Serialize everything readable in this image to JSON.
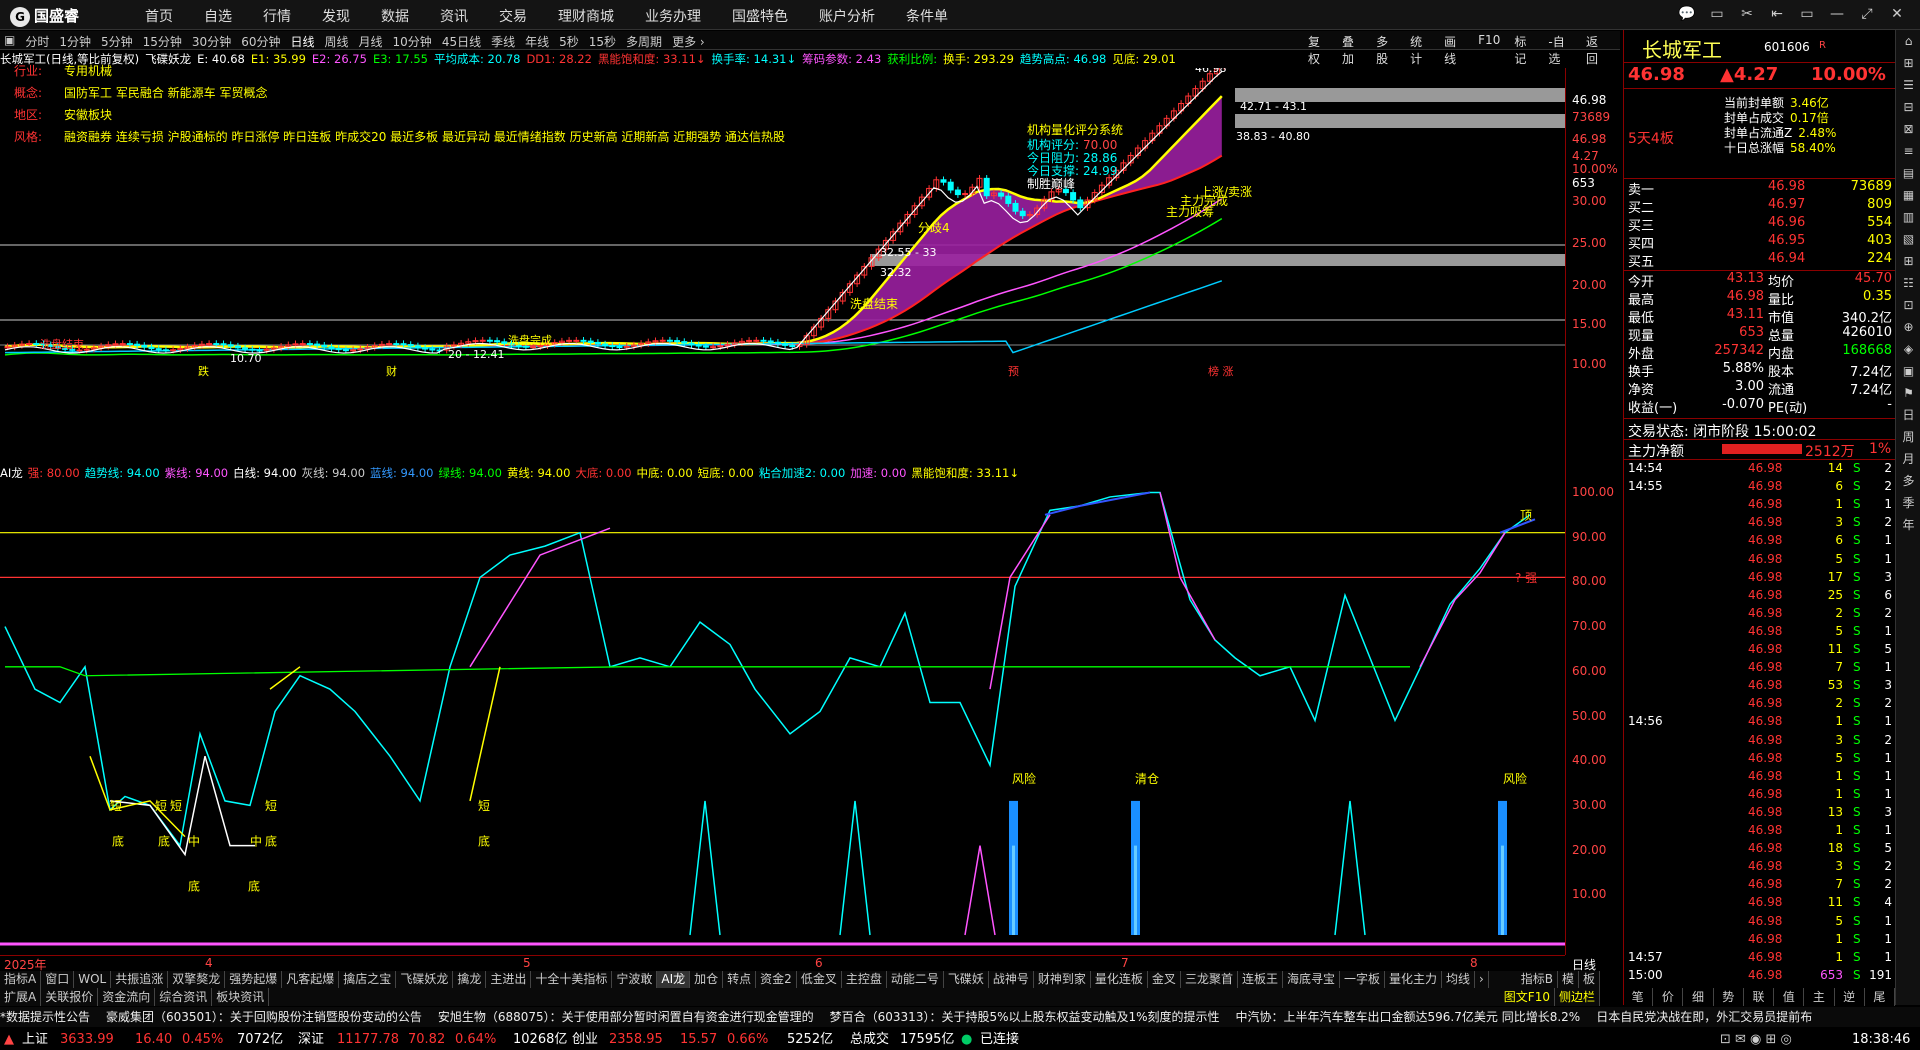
{
  "app": {
    "logo_text": "国盛睿"
  },
  "menu": [
    "首页",
    "自选",
    "行情",
    "发现",
    "数据",
    "资讯",
    "交易",
    "理财商城",
    "业务办理",
    "国盛特色",
    "账户分析",
    "条件单"
  ],
  "window_buttons": [
    "💬",
    "▭",
    "✂",
    "⇤",
    "▭",
    "—",
    "⤢",
    "✕"
  ],
  "periods": [
    "▣",
    "分时",
    "1分钟",
    "5分钟",
    "15分钟",
    "30分钟",
    "60分钟",
    "日线",
    "周线",
    "月线",
    "10分钟",
    "45日线",
    "季线",
    "年线",
    "5秒",
    "15秒",
    "多周期",
    "更多 ›"
  ],
  "period_active": "日线",
  "toolbar_right": [
    "复权",
    "叠加",
    "多股",
    "统计",
    "画线",
    "F10",
    "标记",
    "-自选",
    "返回"
  ],
  "infobar": [
    {
      "t": "长城军工(日线,等比前复权)",
      "c": "#ffffff"
    },
    {
      "t": "飞碟妖龙",
      "c": "#ffffff"
    },
    {
      "t": "E: 40.68",
      "c": "#ffffff"
    },
    {
      "t": "E1: 35.99",
      "c": "#ffff00"
    },
    {
      "t": "E2: 26.75",
      "c": "#ff55ff"
    },
    {
      "t": "E3: 17.55",
      "c": "#00ff00"
    },
    {
      "t": "平均成本: 20.78",
      "c": "#00ffff"
    },
    {
      "t": "DD1: 28.22",
      "c": "#ff3333"
    },
    {
      "t": "黑能饱和度: 33.11↓",
      "c": "#ff3333"
    },
    {
      "t": "换手率: 14.31↓",
      "c": "#00ffff"
    },
    {
      "t": "筹码参数: 2.43",
      "c": "#ff55ff"
    },
    {
      "t": "获利比例:",
      "c": "#00ff00"
    },
    {
      "t": "换手: 293.29",
      "c": "#ffff00"
    },
    {
      "t": "趋势高点: 46.98",
      "c": "#00ffff"
    },
    {
      "t": "见底: 29.01",
      "c": "#ffff00"
    }
  ],
  "overlay_info": [
    {
      "k": "行业:",
      "v": "专用机械"
    },
    {
      "k": "概念:",
      "v": "国防军工 军民融合 新能源车 军贸概念"
    },
    {
      "k": "地区:",
      "v": "安徽板块"
    },
    {
      "k": "风格:",
      "v": "融资融券 连续亏损 沪股通标的 昨日涨停 昨日连板 昨成交20 最近多板 最近异动 最近情绪指数 历史新高 近期新高 近期强势 通达信热股"
    }
  ],
  "scoring": {
    "title": "机构量化评分系统",
    "rows": [
      {
        "k": "机构评分:",
        "v": "70.00",
        "c": "#ff4444"
      },
      {
        "k": "今日阻力:",
        "v": "28.86",
        "c": "#00ffff"
      },
      {
        "k": "今日支撑:",
        "v": "24.99",
        "c": "#00ffff"
      },
      {
        "k": "制胜巅峰",
        "v": "",
        "c": "#ffffff"
      }
    ]
  },
  "chart_labels": {
    "high": "46.98",
    "lvl1": "42.71 - 43.1",
    "lvl2": "38.83 - 40.80",
    "low1": "10.70",
    "low2": "20 - 12.41",
    "mid1": "32.55 - 33",
    "mid2": "32.32",
    "top_text": "5天4板",
    "ann1": "洗盘结束",
    "ann2": "分歧4",
    "ann3": "洗盘结束",
    "ann4": "主力吸筹",
    "ann5": "主力完成",
    "ann6": "上涨/卖涨",
    "ann7": "洗盘完成",
    "bot1": "跌",
    "bot2": "财",
    "bot3": "预",
    "bot4": "榜 涨"
  },
  "main_axis": {
    "top_vals": [
      "46.98",
      "73689",
      "46.98",
      "4.27",
      "10.00%",
      "653"
    ],
    "ticks": [
      "30.00",
      "25.00",
      "20.00",
      "15.00",
      "10.00"
    ]
  },
  "subinfo": [
    {
      "t": "AI龙",
      "c": "#ffffff"
    },
    {
      "t": "强: 80.00",
      "c": "#ff3333"
    },
    {
      "t": "趋势线: 94.00",
      "c": "#00ffff"
    },
    {
      "t": "紫线: 94.00",
      "c": "#ff55ff"
    },
    {
      "t": "白线: 94.00",
      "c": "#ffffff"
    },
    {
      "t": "灰线: 94.00",
      "c": "#cccccc"
    },
    {
      "t": "蓝线: 94.00",
      "c": "#3399ff"
    },
    {
      "t": "绿线: 94.00",
      "c": "#00ff00"
    },
    {
      "t": "黄线: 94.00",
      "c": "#ffff00"
    },
    {
      "t": "大底: 0.00",
      "c": "#ff3333"
    },
    {
      "t": "中底: 0.00",
      "c": "#ffff00"
    },
    {
      "t": "短底: 0.00",
      "c": "#ffff00"
    },
    {
      "t": "粘合加速2: 0.00",
      "c": "#00ffff"
    },
    {
      "t": "加速: 0.00",
      "c": "#ff55ff"
    },
    {
      "t": "黑能饱和度: 33.11↓",
      "c": "#ffff00"
    }
  ],
  "sub_labels": {
    "ding": "顶",
    "qiang": "? 强",
    "fx1": "风险",
    "qc": "清仓",
    "fx2": "风险",
    "duan": "短",
    "di": "底",
    "zhong": "中"
  },
  "sub_axis": [
    "100.00",
    "90.00",
    "80.00",
    "70.00",
    "60.00",
    "50.00",
    "40.00",
    "30.00",
    "20.00",
    "10.00"
  ],
  "date_axis": [
    {
      "t": "2025年"
    },
    {
      "t": "4"
    },
    {
      "t": "5"
    },
    {
      "t": "6"
    },
    {
      "t": "7"
    },
    {
      "t": "8"
    }
  ],
  "tabs1": [
    "指标A",
    "窗口",
    "WOL",
    "共振追涨",
    "双擎獒龙",
    "强势起爆",
    "凡客起爆",
    "擒店之宝",
    "飞碟妖龙",
    "擒龙",
    "主进出",
    "十全十美指标",
    "宁波敢",
    "AI龙",
    "加仓",
    "转点",
    "资金2",
    "低金叉",
    "主控盘",
    "动能二号",
    "飞碟妖",
    "战神号",
    "财神到家",
    "量化连板",
    "金叉",
    "三龙聚首",
    "连板王",
    "海底寻宝",
    "一字板",
    "量化主力",
    "均线",
    "›"
  ],
  "tabs1_right": [
    "指标B",
    "模",
    "板"
  ],
  "tabs2": [
    "扩展A",
    "关联报价",
    "资金流向",
    "综合资讯",
    "板块资讯"
  ],
  "tabs2_right": [
    "图文F10",
    "侧边栏"
  ],
  "ticker": [
    "*数据提示性公告",
    "豪威集团（603501）：关于回购股份注销暨股份变动的公告",
    "安旭生物（688075）：关于使用部分暂时闲置自有资金进行现金管理的",
    "梦百合（603313）：关于持股5%以上股东权益变动触及1%刻度的提示性",
    "中汽协：上半年汽车整车出口金额达596.7亿美元 同比增长8.2%",
    "日本自民党决战在即，外汇交易员提前布"
  ],
  "status": {
    "sh_label": "上证",
    "sh_val": "3633.99",
    "sh_chg": "16.40",
    "sh_pct": "0.45%",
    "sh_amt": "7072亿",
    "sz_label": "深证",
    "sz_val": "11177.78",
    "sz_chg": "70.82",
    "sz_pct": "0.64%",
    "sz_amt": "10268亿",
    "cy_label": "创业",
    "cy_val": "2358.95",
    "cy_chg": "15.57",
    "cy_pct": "0.66%",
    "cy_amt": "5252亿",
    "total_label": "总成交",
    "total_val": "17595亿",
    "conn": "已连接",
    "time": "18:38:46"
  },
  "quote": {
    "name": "长城军工",
    "code": "601606",
    "price": "46.98",
    "change": "▲4.27",
    "pct": "10.00%",
    "info": [
      {
        "k": "当前封单额",
        "v": "3.46亿"
      },
      {
        "k": "封单占成交",
        "v": "0.17倍"
      },
      {
        "k": "封单占流通Z",
        "v": "2.48%"
      },
      {
        "k": "十日总涨幅",
        "v": "58.40%"
      }
    ],
    "board_tag": "5天4板",
    "bids": [
      {
        "k": "卖一",
        "p": "46.98",
        "v": "73689"
      },
      {
        "k": "买二",
        "p": "46.97",
        "v": "809"
      },
      {
        "k": "买三",
        "p": "46.96",
        "v": "554"
      },
      {
        "k": "买四",
        "p": "46.95",
        "v": "403"
      },
      {
        "k": "买五",
        "p": "46.94",
        "v": "224"
      }
    ],
    "stats": [
      {
        "k1": "今开",
        "v1": "43.13",
        "k2": "均价",
        "v2": "45.70"
      },
      {
        "k1": "最高",
        "v1": "46.98",
        "k2": "量比",
        "v2": "0.35"
      },
      {
        "k1": "最低",
        "v1": "43.11",
        "k2": "市值",
        "v2": "340.2亿"
      },
      {
        "k1": "现量",
        "v1": "653",
        "k2": "总量",
        "v2": "426010"
      },
      {
        "k1": "外盘",
        "v1": "257342",
        "k2": "内盘",
        "v2": "168668"
      },
      {
        "k1": "换手",
        "v1": "5.88%",
        "k2": "股本",
        "v2": "7.24亿"
      },
      {
        "k1": "净资",
        "v1": "3.00",
        "k2": "流通",
        "v2": "7.24亿"
      },
      {
        "k1": "收益(一)",
        "v1": "-0.070",
        "k2": "PE(动)",
        "v2": "-"
      }
    ],
    "trade_status": "交易状态: 闭市阶段 15:00:02",
    "net_label": "主力净额",
    "net_val": "2512万",
    "net_pct": "1%",
    "ticks": [
      [
        "14:54",
        "46.98",
        "14",
        "S",
        "2"
      ],
      [
        "14:55",
        "46.98",
        "6",
        "S",
        "2"
      ],
      [
        "",
        "46.98",
        "1",
        "S",
        "1"
      ],
      [
        "",
        "46.98",
        "3",
        "S",
        "2"
      ],
      [
        "",
        "46.98",
        "6",
        "S",
        "1"
      ],
      [
        "",
        "46.98",
        "5",
        "S",
        "1"
      ],
      [
        "",
        "46.98",
        "17",
        "S",
        "3"
      ],
      [
        "",
        "46.98",
        "25",
        "S",
        "6"
      ],
      [
        "",
        "46.98",
        "2",
        "S",
        "2"
      ],
      [
        "",
        "46.98",
        "5",
        "S",
        "1"
      ],
      [
        "",
        "46.98",
        "11",
        "S",
        "5"
      ],
      [
        "",
        "46.98",
        "7",
        "S",
        "1"
      ],
      [
        "",
        "46.98",
        "53",
        "S",
        "3"
      ],
      [
        "",
        "46.98",
        "2",
        "S",
        "2"
      ],
      [
        "14:56",
        "46.98",
        "1",
        "S",
        "1"
      ],
      [
        "",
        "46.98",
        "3",
        "S",
        "2"
      ],
      [
        "",
        "46.98",
        "5",
        "S",
        "1"
      ],
      [
        "",
        "46.98",
        "1",
        "S",
        "1"
      ],
      [
        "",
        "46.98",
        "1",
        "S",
        "1"
      ],
      [
        "",
        "46.98",
        "13",
        "S",
        "3"
      ],
      [
        "",
        "46.98",
        "1",
        "S",
        "1"
      ],
      [
        "",
        "46.98",
        "18",
        "S",
        "5"
      ],
      [
        "",
        "46.98",
        "3",
        "S",
        "2"
      ],
      [
        "",
        "46.98",
        "7",
        "S",
        "2"
      ],
      [
        "",
        "46.98",
        "11",
        "S",
        "4"
      ],
      [
        "",
        "46.98",
        "5",
        "S",
        "1"
      ],
      [
        "",
        "46.98",
        "1",
        "S",
        "1"
      ],
      [
        "14:57",
        "46.98",
        "1",
        "S",
        "1"
      ],
      [
        "15:00",
        "46.98",
        "653",
        "S",
        "191"
      ]
    ],
    "bottom_tabs": [
      "笔",
      "价",
      "细",
      "势",
      "联",
      "值",
      "主",
      "逆",
      "尾"
    ]
  },
  "sidebar_right": [
    "⌂",
    "⊞",
    "☰",
    "⊟",
    "⊠",
    "≡",
    "▤",
    "▦",
    "▥",
    "▧",
    "⊞",
    "☷",
    "⊡",
    "⊕",
    "◈",
    "▣",
    "⚑",
    "日",
    "周",
    "月",
    "多",
    "季",
    "年"
  ],
  "chart_data": {
    "type": "line",
    "main_axis_ticks": [
      10,
      15,
      20,
      25,
      30
    ],
    "sub_axis_ticks": [
      10,
      20,
      30,
      40,
      50,
      60,
      70,
      80,
      90,
      100
    ],
    "sub_ylim": [
      0,
      100
    ],
    "sub_hlines": [
      {
        "value": 80,
        "color": "#ff3333"
      },
      {
        "value": 90,
        "color": "#ffff00"
      }
    ]
  }
}
